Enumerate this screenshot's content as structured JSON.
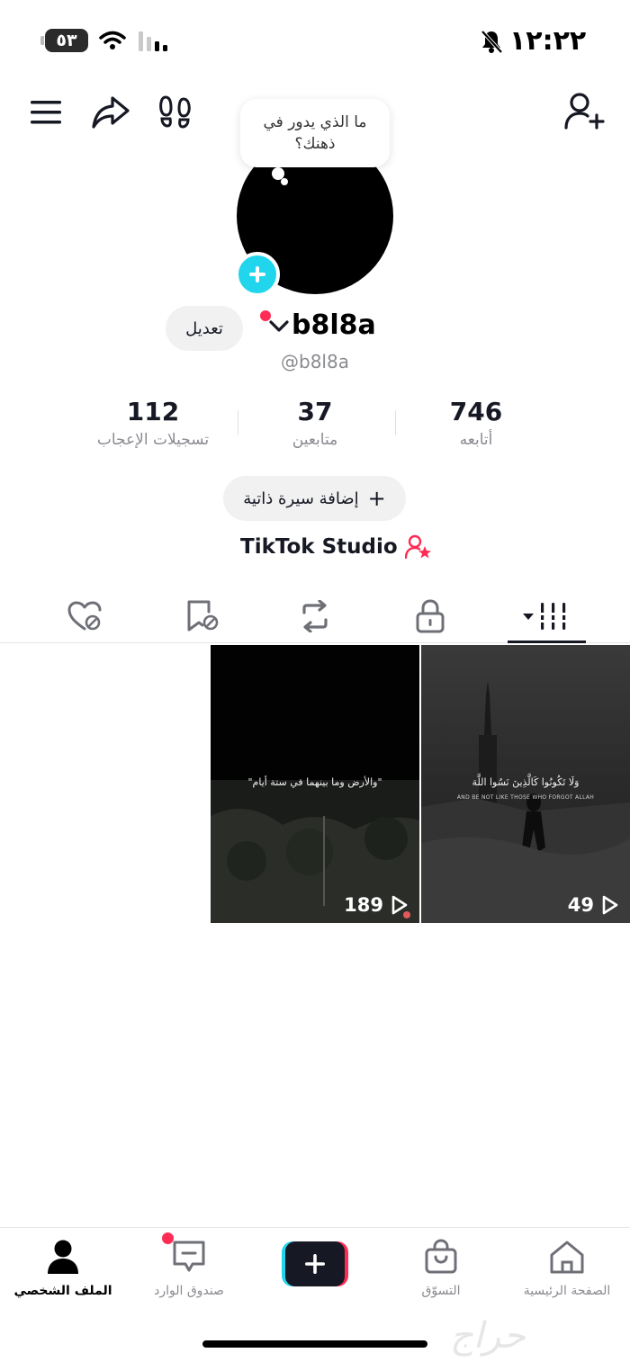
{
  "status_bar": {
    "time": "١٢:٢٢",
    "battery": "٥٣"
  },
  "profile": {
    "thought_bubble": "ما الذي يدور في ذهنك؟",
    "display_name": "b8l8a",
    "username": "@b8l8a",
    "edit_label": "تعديل",
    "stats": {
      "following": {
        "value": "746",
        "label": "أتابعه"
      },
      "followers": {
        "value": "37",
        "label": "متابعين"
      },
      "likes": {
        "value": "112",
        "label": "تسجيلات الإعجاب"
      }
    },
    "bio_button": "إضافة سيرة ذاتية",
    "studio_label": "TikTok Studio"
  },
  "tabs": [
    {
      "name": "videos",
      "icon": "grid-icon",
      "active": true
    },
    {
      "name": "private",
      "icon": "lock-icon"
    },
    {
      "name": "reposts",
      "icon": "repost-icon"
    },
    {
      "name": "favorites",
      "icon": "bookmark-icon"
    },
    {
      "name": "liked",
      "icon": "heart-icon"
    }
  ],
  "videos": [
    {
      "views": "49",
      "caption": "وَلَا تَكُونُوا كَالَّذِينَ نَسُوا اللَّهَ",
      "subtitle": "AND BE NOT LIKE THOSE WHO FORGOT ALLAH"
    },
    {
      "views": "189",
      "caption": "\"والأرض وما بينهما في ستة أيام\""
    }
  ],
  "bottom_nav": {
    "home": "الصفحة الرئيسية",
    "shop": "التسوّق",
    "inbox": "صندوق الوارد",
    "profile": "الملف الشخصي"
  },
  "watermark": "حراج",
  "colors": {
    "accent_cyan": "#20d5ec",
    "accent_red": "#fe2c55",
    "text": "#161823",
    "muted": "#8a8b91"
  }
}
